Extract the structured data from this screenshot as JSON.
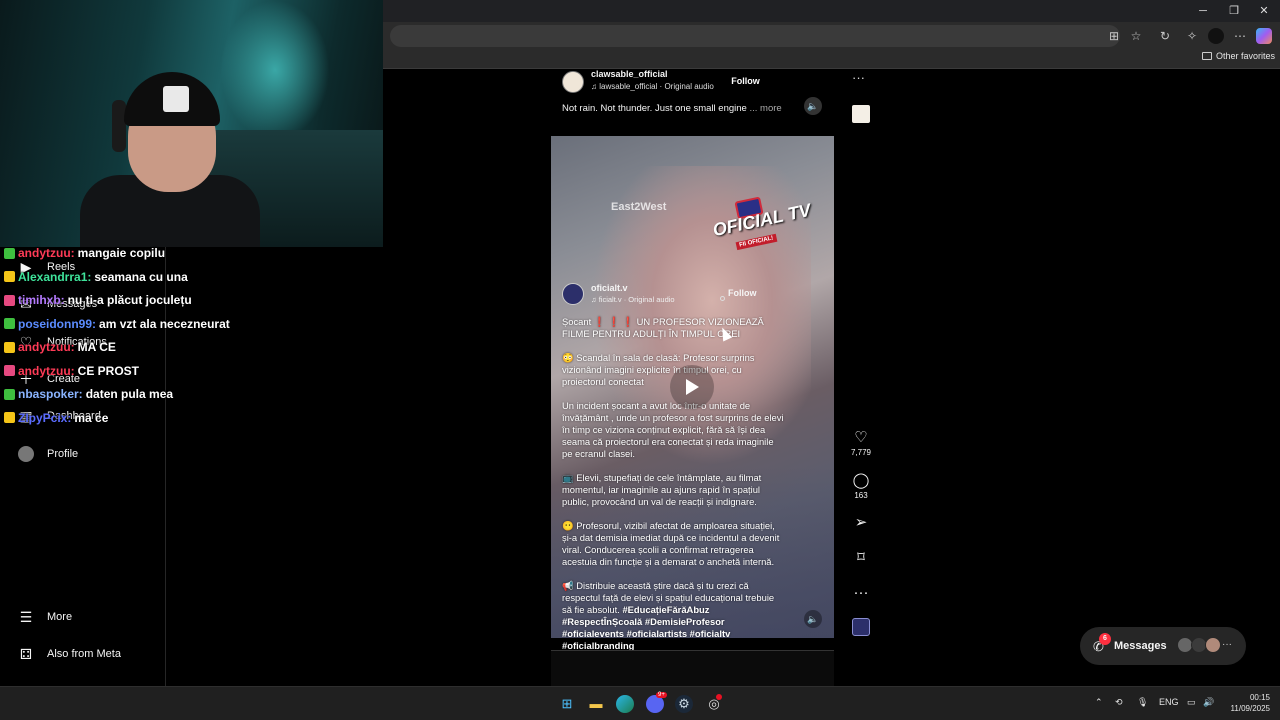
{
  "browser": {
    "window_controls": {
      "minimize": "─",
      "restore": "❐",
      "close": "✕"
    },
    "toolbar_icons": [
      "apps-icon",
      "star-icon",
      "refresh-icon",
      "favorites-icon",
      "profile-icon",
      "more-icon",
      "copilot-icon"
    ],
    "favorites_label": "Other favorites"
  },
  "nav": {
    "items": [
      {
        "name": "reels",
        "label": "Reels",
        "icon": "▶"
      },
      {
        "name": "messages",
        "label": "Messages",
        "icon": "✉"
      },
      {
        "name": "notifications",
        "label": "Notifications",
        "icon": "♡"
      },
      {
        "name": "create",
        "label": "Create",
        "icon": "＋"
      },
      {
        "name": "dashboard",
        "label": "Dashboard",
        "icon": "▦"
      },
      {
        "name": "profile",
        "label": "Profile",
        "icon": "●"
      }
    ],
    "more_label": "More",
    "more_icon": "☰",
    "meta_label": "Also from Meta",
    "meta_icon": "⚃"
  },
  "chat": [
    {
      "user": "andytzuu",
      "color": "#ff3b57",
      "message": "mangaie copilu"
    },
    {
      "user": "Alexandrra1",
      "color": "#3fe39b",
      "message": "seamana cu una"
    },
    {
      "user": "timihxb",
      "color": "#b57bff",
      "message": "nu ți-a plăcut joculețu"
    },
    {
      "user": "poseidonn99",
      "color": "#5b8cff",
      "message": "am vzt ala necezneurat"
    },
    {
      "user": "andytzuu",
      "color": "#ff3b57",
      "message": "MA CE"
    },
    {
      "user": "andytzuu",
      "color": "#ff3b57",
      "message": "CE PROST"
    },
    {
      "user": "nbaspoker",
      "color": "#8ab4ff",
      "message": "daten pula mea"
    },
    {
      "user": "ZIpyPcix",
      "color": "#5b6cff",
      "message": "ma ce"
    }
  ],
  "post": {
    "username": "clawsable_official",
    "audio": "♫ lawsable_official · Original audio",
    "follow_label": "Follow",
    "more_icon": "···",
    "caption": "Not rain. Not thunder. Just one small engine",
    "caption_more": "... more",
    "speaker_icon": "🔈"
  },
  "video": {
    "watermark": "East2West",
    "logo": "OFICIAL TV",
    "logo_sub": "FII OFICIAL!",
    "username": "oficialt.v",
    "audio": "♫ ficialt.v · Original audio",
    "follow_label": "Follow",
    "paragraphs": [
      {
        "segments": [
          {
            "t": "Șocant ",
            "c": ""
          },
          {
            "t": "❗ ❗ ❗ ",
            "c": "hl"
          },
          {
            "t": "UN PROFESOR VIZIONEAZĂ FILME PENTRU ADULȚI ÎN TIMPUL OREI",
            "c": ""
          }
        ]
      },
      {
        "segments": [
          {
            "t": "😳 Scandal în sala de clasă: Profesor surprins vizionând imagini explicite în timpul orei, cu proiectorul conectat",
            "c": ""
          }
        ]
      },
      {
        "segments": [
          {
            "t": "Un incident șocant a avut loc într-o unitate de învățământ , unde un profesor a fost surprins de elevi în timp ce viziona conținut explicit, fără să își dea seama că proiectorul era conectat și reda imaginile pe ecranul clasei.",
            "c": ""
          }
        ]
      },
      {
        "segments": [
          {
            "t": "📺 Elevii, stupefiați de cele întâmplate, au filmat momentul, iar imaginile au ajuns rapid în spațiul public, provocând un val de reacții și indignare.",
            "c": ""
          }
        ]
      },
      {
        "segments": [
          {
            "t": "😶 Profesorul, vizibil afectat de amploarea situației, și-a dat demisia imediat după ce incidentul a devenit viral. Conducerea școlii a confirmat retragerea acestuia din funcție și a demarat o anchetă internă.",
            "c": ""
          }
        ]
      },
      {
        "segments": [
          {
            "t": "📢 Distribuie această știre dacă și tu crezi că respectul față de elevi și spațiul educațional trebuie să fie absolut. ",
            "c": ""
          },
          {
            "t": "#EducațieFărăAbuz #RespectÎnȘcoală #DemisieProfesor #oficialevents #oficialartists #oficialtv #oficialbranding",
            "c": "b"
          }
        ]
      }
    ]
  },
  "actions": {
    "like_icon": "♡",
    "like_count": "7,779",
    "comment_icon": "◯",
    "comment_count": "163",
    "share_icon": "➢",
    "save_icon": "⌑",
    "more_icon": "···"
  },
  "messages_pill": {
    "label": "Messages",
    "badge": "6",
    "more": "···"
  },
  "taskbar": {
    "apps": [
      "windows-start-icon",
      "file-explorer-icon",
      "edge-icon",
      "discord-icon",
      "steam-icon",
      "obs-icon"
    ],
    "discord_badge": "9+",
    "language": "ENG",
    "time": "00:15",
    "date": "11/09/2025"
  },
  "colors": {
    "accent": "#0095f6",
    "badge": "#ff3040"
  }
}
